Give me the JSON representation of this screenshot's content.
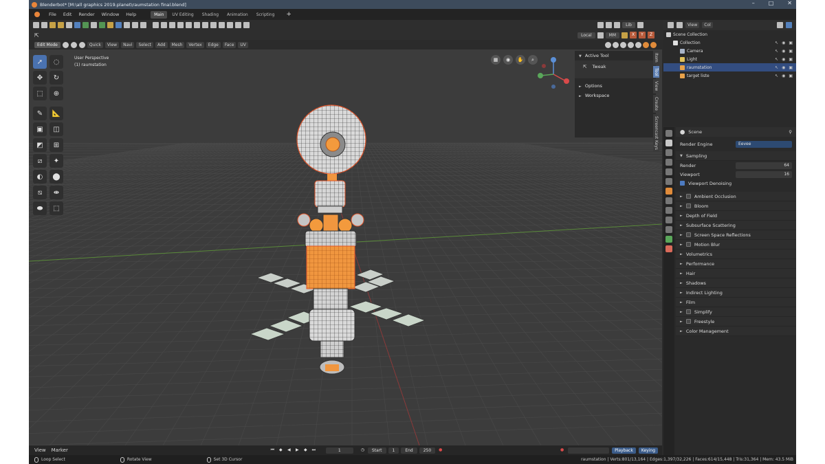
{
  "title": "Blenderbot* [M:\\all graphics 2019.planet\\raumstation final.blend]",
  "menu": [
    "File",
    "Edit",
    "Render",
    "Window",
    "Help"
  ],
  "workspaces": [
    "Main",
    "UV Editing",
    "Shading",
    "Animation",
    "Scripting"
  ],
  "active_workspace": "Main",
  "toolbar": {
    "lib_label": "Lib"
  },
  "transform": {
    "orientation": "Local",
    "pivot": "MM",
    "axes": [
      "X",
      "Y",
      "Z"
    ]
  },
  "viewport_header": {
    "mode": "Edit Mode",
    "buttons": [
      "Quick",
      "View",
      "Navi",
      "Select",
      "Add",
      "Mesh",
      "Vertex",
      "Edge",
      "Face",
      "UV"
    ]
  },
  "viewport_info": {
    "line1": "User Perspective",
    "line2": "(1) raumstation"
  },
  "npanel": {
    "active_tool_label": "Active Tool",
    "tool_name": "Tweak",
    "options_label": "Options",
    "workspace_label": "Workspace",
    "tabs": [
      "Item",
      "Tool",
      "View",
      "Create",
      "Screencast Keys"
    ]
  },
  "outliner": {
    "tabs": [
      "View",
      "Col"
    ],
    "items": [
      {
        "name": "Scene Collection",
        "indent": 0,
        "color": "#cfcfcf",
        "selected": false
      },
      {
        "name": "Collection",
        "indent": 1,
        "color": "#e0e0e0",
        "selected": false
      },
      {
        "name": "Camera",
        "indent": 2,
        "color": "#a7b4c8",
        "selected": false
      },
      {
        "name": "Light",
        "indent": 2,
        "color": "#e0c15b",
        "selected": false
      },
      {
        "name": "raumstation",
        "indent": 2,
        "color": "#e8a24a",
        "selected": true
      },
      {
        "name": "target liste",
        "indent": 2,
        "color": "#e8a24a",
        "selected": false
      }
    ]
  },
  "properties": {
    "scene_label": "Scene",
    "render_engine_label": "Render Engine",
    "render_engine_value": "Eevee",
    "sampling_label": "Sampling",
    "render_label": "Render",
    "render_value": "64",
    "viewport_label": "Viewport",
    "viewport_value": "16",
    "denoising_label": "Viewport Denoising",
    "panels": [
      {
        "label": "Ambient Occlusion",
        "checkbox": true
      },
      {
        "label": "Bloom",
        "checkbox": true
      },
      {
        "label": "Depth of Field",
        "checkbox": false
      },
      {
        "label": "Subsurface Scattering",
        "checkbox": false
      },
      {
        "label": "Screen Space Reflections",
        "checkbox": true
      },
      {
        "label": "Motion Blur",
        "checkbox": true
      },
      {
        "label": "Volumetrics",
        "checkbox": false
      },
      {
        "label": "Performance",
        "checkbox": false
      },
      {
        "label": "Hair",
        "checkbox": false
      },
      {
        "label": "Shadows",
        "checkbox": false
      },
      {
        "label": "Indirect Lighting",
        "checkbox": false
      },
      {
        "label": "Film",
        "checkbox": false
      },
      {
        "label": "Simplify",
        "checkbox": true
      },
      {
        "label": "Freestyle",
        "checkbox": true
      },
      {
        "label": "Color Management",
        "checkbox": false
      }
    ]
  },
  "timeline": {
    "view_label": "View",
    "marker_label": "Marker",
    "current_frame": "1",
    "start_label": "Start",
    "start_value": "1",
    "end_label": "End",
    "end_value": "250",
    "playback_label": "Playback",
    "keying_label": "Keying"
  },
  "status": {
    "loop_select": "Loop Select",
    "rotate_view": "Rotate View",
    "set_cursor": "Set 3D Cursor",
    "stats": "raumstation | Verts:801/13,164 | Edges:1,397/32,226 | Faces:614/15,448 | Tris:31,364 | Mem: 43.5 MiB"
  },
  "colors": {
    "accent": "#e8853a",
    "selection": "#334d80",
    "grid_x": "#8b3a3a",
    "grid_y": "#5a8a3a"
  }
}
